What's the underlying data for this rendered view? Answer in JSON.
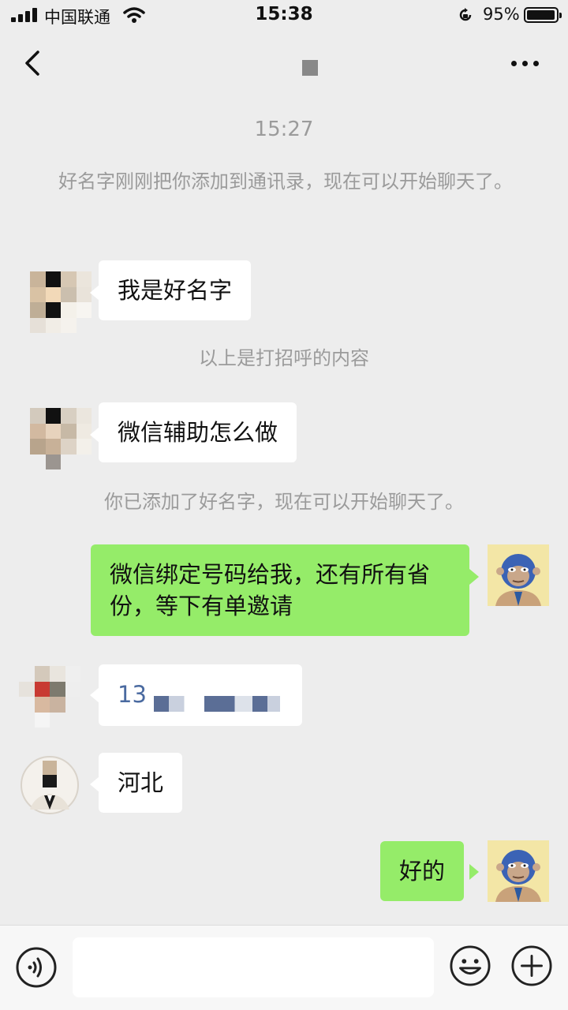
{
  "status_bar": {
    "carrier": "中国联通",
    "time": "15:38",
    "battery": "95%"
  },
  "nav": {
    "back_icon": "chevron-left-icon",
    "more_icon": "more-dots-icon"
  },
  "timestamp": "15:27",
  "system_messages": {
    "added_notice": "好名字刚刚把你添加到通讯录，现在可以开始聊天了。",
    "greeting_divider": "以上是打招呼的内容",
    "start_chat": "你已添加了好名字，现在可以开始聊天了。"
  },
  "messages": [
    {
      "side": "in",
      "text": "我是好名字"
    },
    {
      "side": "in",
      "text": "微信辅助怎么做"
    },
    {
      "side": "out",
      "text": "微信绑定号码给我，还有所有省份，等下有单邀请"
    },
    {
      "side": "in",
      "text": "13"
    },
    {
      "side": "in",
      "text": "河北"
    },
    {
      "side": "out",
      "text": "好的"
    }
  ],
  "input_bar": {
    "voice_icon": "voice-icon",
    "emoji_icon": "emoji-icon",
    "plus_icon": "plus-icon"
  },
  "colors": {
    "outgoing_bubble": "#95ec69",
    "incoming_bubble": "#ffffff",
    "background": "#ededed"
  }
}
